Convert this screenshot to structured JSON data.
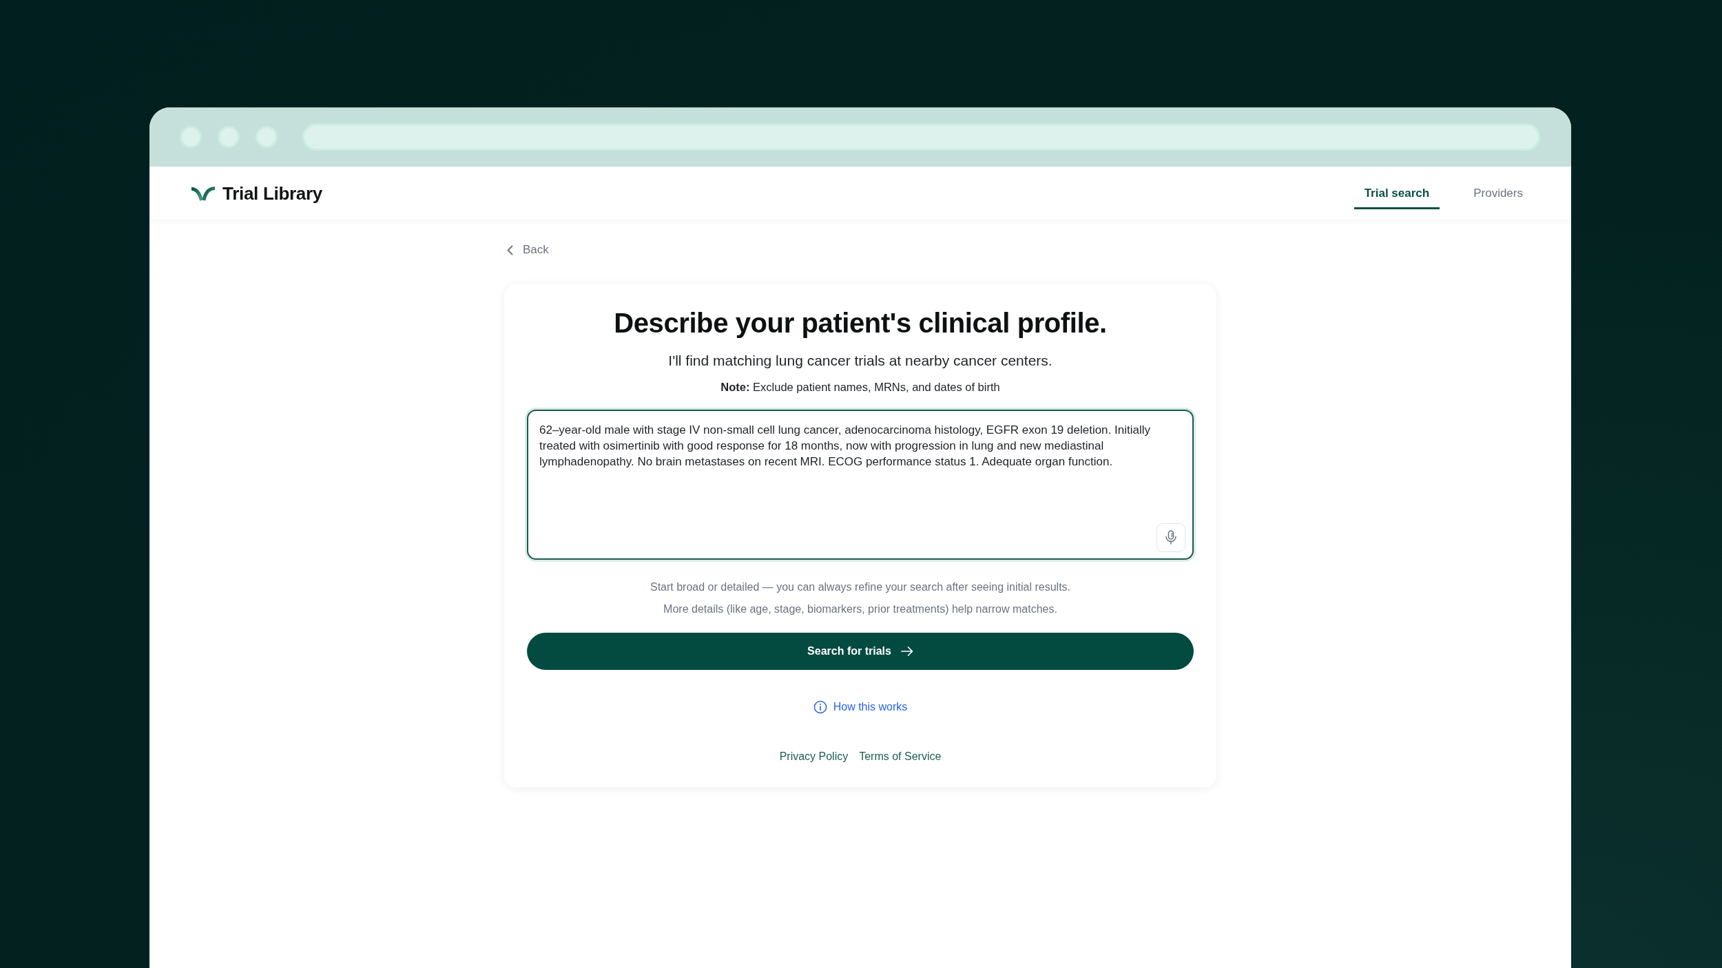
{
  "header": {
    "logo_text": "Trial Library",
    "tabs": [
      {
        "label": "Trial search",
        "selected": true
      },
      {
        "label": "Providers",
        "selected": false
      }
    ]
  },
  "back_link": "Back",
  "form": {
    "title": "Describe your patient's clinical profile.",
    "subtitle": "I'll find matching lung cancer trials at nearby cancer centers.",
    "note": "**Note:** Exclude patient names, MRNs, and dates of birth",
    "profile_field": {
      "value": "62–year-old male with stage IV non-small cell lung cancer, adenocarcinoma histology, EGFR exon 19 deletion. Initially treated with osimertinib with good response for 18 months, now with progression in lung and new mediastinal lymphadenopathy. No brain metastases on recent MRI. ECOG performance status 1. Adequate organ function."
    },
    "hints": [
      "Start broad or detailed — you can always refine your search after seeing initial results.",
      "More details (like age, stage, biomarkers, prior treatments) help narrow matches."
    ],
    "submit_button": "Search for trials",
    "help_link": "How this works",
    "footer_links": [
      "Privacy Policy",
      "Terms of Service"
    ]
  }
}
